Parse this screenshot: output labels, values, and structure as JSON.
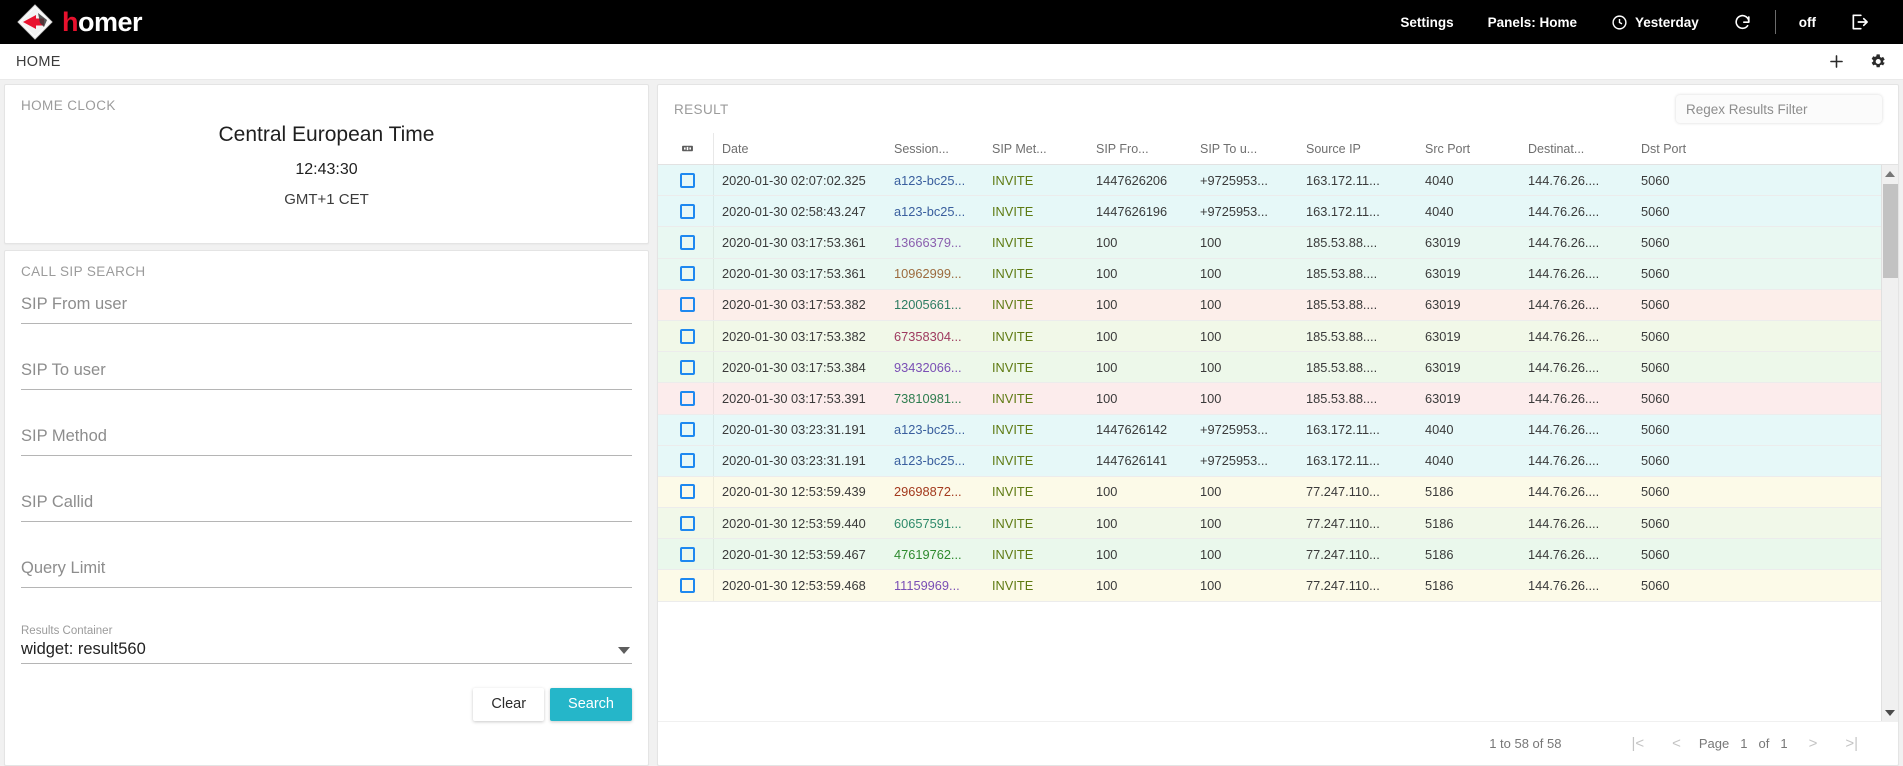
{
  "brand": {
    "name_first": "h",
    "name_rest": "omer",
    "logo_icon": "homer-diamond-logo"
  },
  "topnav": {
    "settings": "Settings",
    "panels": "Panels: Home",
    "timerange": "Yesterday",
    "clock_icon": "clock-icon",
    "refresh_icon": "refresh-icon",
    "auto_refresh": "off",
    "logout_icon": "logout-icon"
  },
  "homebar": {
    "title": "HOME",
    "add_icon": "plus-icon",
    "settings_icon": "gear-icon"
  },
  "clock_widget": {
    "title": "HOME CLOCK",
    "zone": "Central European Time",
    "time": "12:43:30",
    "offset": "GMT+1 CET"
  },
  "search_widget": {
    "title": "CALL SIP SEARCH",
    "fields": [
      {
        "name": "sip-from-user",
        "placeholder": "SIP From user",
        "value": ""
      },
      {
        "name": "sip-to-user",
        "placeholder": "SIP To user",
        "value": ""
      },
      {
        "name": "sip-method",
        "placeholder": "SIP Method",
        "value": ""
      },
      {
        "name": "sip-callid",
        "placeholder": "SIP Callid",
        "value": ""
      },
      {
        "name": "query-limit",
        "placeholder": "Query Limit",
        "value": ""
      }
    ],
    "results_container": {
      "label": "Results Container",
      "value": "widget: result560"
    },
    "clear_label": "Clear",
    "search_label": "Search"
  },
  "result_widget": {
    "title": "RESULT",
    "filter_placeholder": "Regex Results Filter",
    "select_all_icon": "select-all-icon",
    "columns": [
      "Date",
      "Session...",
      "SIP Met...",
      "SIP Fro...",
      "SIP To u...",
      "Source IP",
      "Src Port",
      "Destinat...",
      "Dst Port"
    ],
    "rows": [
      {
        "date": "2020-01-30 02:07:02.325",
        "session": "a123-bc25...",
        "session_color": "#3a5f9e",
        "method": "INVITE",
        "from": "1447626206",
        "to": "+9725953...",
        "src_ip": "163.172.11...",
        "src_port": "4040",
        "dst_ip": "144.76.26....",
        "dst_port": "5060",
        "bg": "#e6f8f8"
      },
      {
        "date": "2020-01-30 02:58:43.247",
        "session": "a123-bc25...",
        "session_color": "#3a5f9e",
        "method": "INVITE",
        "from": "1447626196",
        "to": "+9725953...",
        "src_ip": "163.172.11...",
        "src_port": "4040",
        "dst_ip": "144.76.26....",
        "dst_port": "5060",
        "bg": "#e6f8f8"
      },
      {
        "date": "2020-01-30 03:17:53.361",
        "session": "13666379...",
        "session_color": "#8a5fae",
        "method": "INVITE",
        "from": "100",
        "to": "100",
        "src_ip": "185.53.88....",
        "src_port": "63019",
        "dst_ip": "144.76.26....",
        "dst_port": "5060",
        "bg": "#e9f8f2"
      },
      {
        "date": "2020-01-30 03:17:53.361",
        "session": "10962999...",
        "session_color": "#9c6b3e",
        "method": "INVITE",
        "from": "100",
        "to": "100",
        "src_ip": "185.53.88....",
        "src_port": "63019",
        "dst_ip": "144.76.26....",
        "dst_port": "5060",
        "bg": "#e9f8f1"
      },
      {
        "date": "2020-01-30 03:17:53.382",
        "session": "12005661...",
        "session_color": "#2e7d63",
        "method": "INVITE",
        "from": "100",
        "to": "100",
        "src_ip": "185.53.88....",
        "src_port": "63019",
        "dst_ip": "144.76.26....",
        "dst_port": "5060",
        "bg": "#fceeea"
      },
      {
        "date": "2020-01-30 03:17:53.382",
        "session": "67358304...",
        "session_color": "#9e3a5f",
        "method": "INVITE",
        "from": "100",
        "to": "100",
        "src_ip": "185.53.88....",
        "src_port": "63019",
        "dst_ip": "144.76.26....",
        "dst_port": "5060",
        "bg": "#f1f8e8"
      },
      {
        "date": "2020-01-30 03:17:53.384",
        "session": "93432066...",
        "session_color": "#7a4fb5",
        "method": "INVITE",
        "from": "100",
        "to": "100",
        "src_ip": "185.53.88....",
        "src_port": "63019",
        "dst_ip": "144.76.26....",
        "dst_port": "5060",
        "bg": "#edf8ea"
      },
      {
        "date": "2020-01-30 03:17:53.391",
        "session": "73810981...",
        "session_color": "#2e7d4f",
        "method": "INVITE",
        "from": "100",
        "to": "100",
        "src_ip": "185.53.88....",
        "src_port": "63019",
        "dst_ip": "144.76.26....",
        "dst_port": "5060",
        "bg": "#fcecec"
      },
      {
        "date": "2020-01-30 03:23:31.191",
        "session": "a123-bc25...",
        "session_color": "#3a5f9e",
        "method": "INVITE",
        "from": "1447626142",
        "to": "+9725953...",
        "src_ip": "163.172.11...",
        "src_port": "4040",
        "dst_ip": "144.76.26....",
        "dst_port": "5060",
        "bg": "#e6f8f8"
      },
      {
        "date": "2020-01-30 03:23:31.191",
        "session": "a123-bc25...",
        "session_color": "#3a5f9e",
        "method": "INVITE",
        "from": "1447626141",
        "to": "+9725953...",
        "src_ip": "163.172.11...",
        "src_port": "4040",
        "dst_ip": "144.76.26....",
        "dst_port": "5060",
        "bg": "#e6f8f8"
      },
      {
        "date": "2020-01-30 12:53:59.439",
        "session": "29698872...",
        "session_color": "#a33a1e",
        "method": "INVITE",
        "from": "100",
        "to": "100",
        "src_ip": "77.247.110...",
        "src_port": "5186",
        "dst_ip": "144.76.26....",
        "dst_port": "5060",
        "bg": "#fcfae8"
      },
      {
        "date": "2020-01-30 12:53:59.440",
        "session": "60657591...",
        "session_color": "#2e8a6b",
        "method": "INVITE",
        "from": "100",
        "to": "100",
        "src_ip": "77.247.110...",
        "src_port": "5186",
        "dst_ip": "144.76.26....",
        "dst_port": "5060",
        "bg": "#f1f8e9"
      },
      {
        "date": "2020-01-30 12:53:59.467",
        "session": "47619762...",
        "session_color": "#2e8a2e",
        "method": "INVITE",
        "from": "100",
        "to": "100",
        "src_ip": "77.247.110...",
        "src_port": "5186",
        "dst_ip": "144.76.26....",
        "dst_port": "5060",
        "bg": "#eaf8ec"
      },
      {
        "date": "2020-01-30 12:53:59.468",
        "session": "11159969...",
        "session_color": "#7a4fb5",
        "method": "INVITE",
        "from": "100",
        "to": "100",
        "src_ip": "77.247.110...",
        "src_port": "5186",
        "dst_ip": "144.76.26....",
        "dst_port": "5060",
        "bg": "#fcfae8"
      }
    ],
    "pager": {
      "count": "1 to 58 of 58",
      "first_icon": "first-page-icon",
      "prev_icon": "prev-page-icon",
      "page_label": "Page",
      "page_current": "1",
      "of_label": "of",
      "page_total": "1",
      "next_icon": "next-page-icon",
      "last_icon": "last-page-icon"
    }
  }
}
